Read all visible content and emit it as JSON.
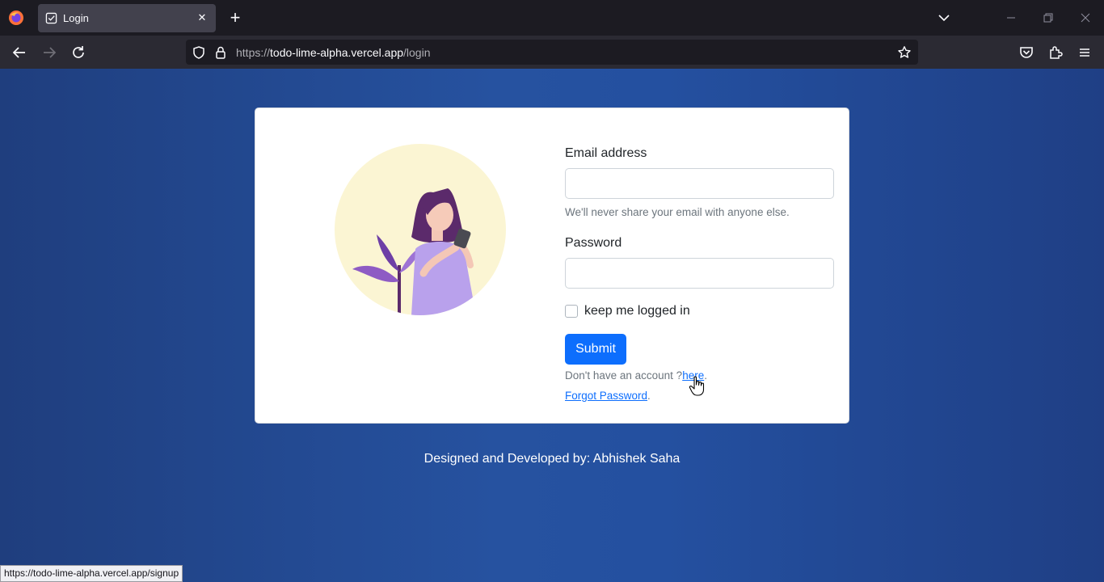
{
  "browser": {
    "tab": {
      "title": "Login"
    },
    "url": {
      "scheme": "https://",
      "host": "todo-lime-alpha.vercel.app",
      "path": "/login"
    },
    "status_url": "https://todo-lime-alpha.vercel.app/signup"
  },
  "form": {
    "email": {
      "label": "Email address",
      "value": "",
      "help": "We'll never share your email with anyone else."
    },
    "password": {
      "label": "Password",
      "value": ""
    },
    "remember": {
      "label": "keep me logged in",
      "checked": false
    },
    "submit_label": "Submit",
    "signup": {
      "prefix": "Don't have an account ?",
      "link": "here",
      "suffix": "."
    },
    "forgot": {
      "link": "Forgot Password",
      "suffix": "."
    }
  },
  "footer": {
    "text": "Designed and Developed by: Abhishek Saha"
  },
  "colors": {
    "accent": "#0d6efd",
    "page_bg": "#2450a0",
    "card_bg": "#ffffff"
  }
}
